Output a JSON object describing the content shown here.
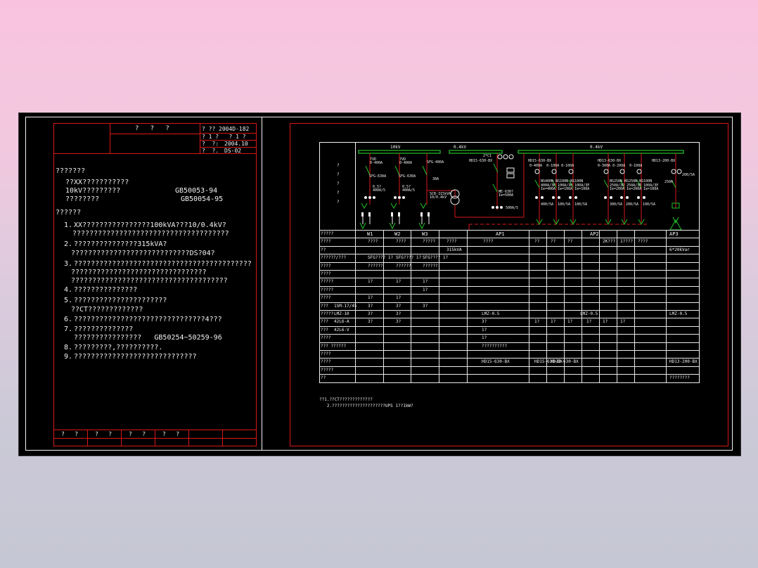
{
  "left_sheet": {
    "title_block": {
      "title": "?   ?   ?",
      "rows": [
        {
          "label": "? ??",
          "value": "2004D-182"
        },
        {
          "label": "? 1 ?   ? 1 ?",
          "value": ""
        },
        {
          "label": "?  ?:",
          "value": "2004.10"
        },
        {
          "label": "?  ?.",
          "value": "DS-02"
        }
      ]
    },
    "heading": "???????",
    "intro": [
      "??XX???????????",
      "10kV?????????",
      "????????"
    ],
    "standards": [
      "GB50053-94",
      "GB50054-95"
    ],
    "section_heading": "??????",
    "notes": [
      {
        "n": "1.",
        "lines": [
          "XX????????????????100kVA???10/0.4kV?",
          "?????????????????????????????????????"
        ]
      },
      {
        "n": "2.",
        "lines": [
          "???????????????315kVA?",
          "????????????????????????????DS?04?"
        ]
      },
      {
        "n": "3.",
        "lines": [
          "??????????????????????????????????????????",
          "????????????????????????????????",
          "?????????????????????????????????????"
        ]
      },
      {
        "n": "4.",
        "lines": [
          "???????????????"
        ]
      },
      {
        "n": "5.",
        "lines": [
          "??????????????????????",
          "??CT?????????????"
        ]
      },
      {
        "n": "6.",
        "lines": [
          "???????????????????????????????4???"
        ]
      },
      {
        "n": "7.",
        "lines": [
          "??????????????",
          "????????????????   GB50254~50259-96"
        ]
      },
      {
        "n": "8.",
        "lines": [
          "?????????,??????????."
        ]
      },
      {
        "n": "9.",
        "lines": [
          "?????????????????????????????"
        ]
      }
    ],
    "signature_row": [
      "?   ?",
      "?   ?",
      "?   ?",
      "?   ?"
    ]
  },
  "right_sheet": {
    "bus_labels": {
      "hv": "10kV",
      "lv1": "0.4kV",
      "lv2": "0.4kV"
    },
    "left_labels": [
      "?",
      "?",
      "?",
      "?",
      "?"
    ],
    "hv_switches": [
      {
        "top": "7VD\n0-400A",
        "mid": "SFG-630A",
        "low": "0.5?\n400A/5"
      },
      {
        "top": "7VD\n0-400A",
        "mid": "SFG-630A",
        "low": "0.5?\n400A/5"
      },
      {
        "top": "SFG-400A",
        "mid": "30A",
        "low": "SCB-315kVA\n10/0.4kV"
      }
    ],
    "transformer": "SCB-315kVA 10/0.4kV",
    "lv_main": {
      "breaker": "HD15-630-BX",
      "ct": "2*C1",
      "aux": "ME-630?\nIe=500A",
      "ratio": "500A/5"
    },
    "feeder_groups": [
      {
        "head": "HD15-630-BX",
        "range": "0-400A  0-100A 0-100A",
        "breakers": "NS400N NS100N NS100N\n400A/3P 100A/3P 100A/3P\nIe=400A Ie=100A Ie=100A",
        "cts": [
          "400/5A",
          "100/5A",
          "100/5A"
        ]
      },
      {
        "head": "HD13-630-BX",
        "range": "0-300A 0-200A  0-100A",
        "breakers": "NS250N NS250N NS100N\n250A/3P 250A/3P 100A/3P\nIe=200A Ie=200A Ie=100A",
        "cts": [
          "300/5A",
          "200/5A",
          "100/5A"
        ]
      },
      {
        "head": "HD13-200-BX",
        "range": "",
        "breakers": "250A",
        "cts": [
          "200/5A"
        ]
      }
    ],
    "table": {
      "row_labels": [
        "?????",
        "????",
        "??",
        "??????/???",
        "????",
        "????",
        "?????",
        "?????",
        "????",
        "???",
        "?????",
        "???",
        "???",
        "????",
        "??? ??????",
        "????",
        "????",
        "?????",
        "??"
      ],
      "col_headers": [
        "W1",
        "W2",
        "W3",
        "AP1",
        "AP2",
        "AP3"
      ],
      "cells": [
        {
          "r": 1,
          "c": "W1",
          "v": "????"
        },
        {
          "r": 1,
          "c": "W2",
          "v": "????"
        },
        {
          "r": 1,
          "c": "W3",
          "v": "?????"
        },
        {
          "r": 1,
          "c": "AP1a",
          "v": "????"
        },
        {
          "r": 1,
          "c": "AP1b",
          "v": "????"
        },
        {
          "r": 1,
          "c": "AP2a",
          "v": "??"
        },
        {
          "r": 1,
          "c": "AP2b",
          "v": "??"
        },
        {
          "r": 1,
          "c": "AP2c",
          "v": "??"
        },
        {
          "r": 1,
          "c": "AP2e",
          "v": "2K???"
        },
        {
          "r": 1,
          "c": "AP2f",
          "v": "1????"
        },
        {
          "r": 1,
          "c": "AP2g",
          "v": "????"
        },
        {
          "r": 2,
          "c": "AP1a",
          "v": "315kVA"
        },
        {
          "r": 2,
          "c": "AP3",
          "v": "6*20kVar"
        },
        {
          "r": 3,
          "c": "W1",
          "v": "SFG???? 1?"
        },
        {
          "r": 3,
          "c": "W2",
          "v": "SFG???? 1?"
        },
        {
          "r": 3,
          "c": "W3",
          "v": "SFG???? 1?"
        },
        {
          "r": 4,
          "c": "W1",
          "v": "??????"
        },
        {
          "r": 4,
          "c": "W2",
          "v": "??????"
        },
        {
          "r": 4,
          "c": "W3",
          "v": "??????"
        },
        {
          "r": 6,
          "c": "W1",
          "v": "1?"
        },
        {
          "r": 6,
          "c": "W2",
          "v": "1?"
        },
        {
          "r": 6,
          "c": "W3",
          "v": "1?"
        },
        {
          "r": 7,
          "c": "W3",
          "v": "1?"
        },
        {
          "r": 8,
          "c": "W1",
          "v": "1?"
        },
        {
          "r": 8,
          "c": "W2",
          "v": "1?"
        },
        {
          "r": 9,
          "c": "label2",
          "v": "1SM-17/45"
        },
        {
          "r": 9,
          "c": "W1",
          "v": "3?"
        },
        {
          "r": 9,
          "c": "W2",
          "v": "3?"
        },
        {
          "r": 9,
          "c": "W3",
          "v": "3?"
        },
        {
          "r": 10,
          "c": "label2",
          "v": "LMZ-10"
        },
        {
          "r": 10,
          "c": "W1",
          "v": "3?"
        },
        {
          "r": 10,
          "c": "W2",
          "v": "3?"
        },
        {
          "r": 10,
          "c": "AP1",
          "v": "LMZ-0.5"
        },
        {
          "r": 10,
          "c": "AP2",
          "v": "LMZ-0.5"
        },
        {
          "r": 10,
          "c": "AP3",
          "v": "LMZ-0.5"
        },
        {
          "r": 11,
          "c": "label2",
          "v": "42L6-A"
        },
        {
          "r": 11,
          "c": "W1",
          "v": "3?"
        },
        {
          "r": 11,
          "c": "W2",
          "v": "3?"
        },
        {
          "r": 11,
          "c": "AP1",
          "v": "3?"
        },
        {
          "r": 11,
          "c": "AP2a",
          "v": "1?"
        },
        {
          "r": 11,
          "c": "AP2b",
          "v": "1?"
        },
        {
          "r": 11,
          "c": "AP2c",
          "v": "1?"
        },
        {
          "r": 11,
          "c": "AP2d",
          "v": "1?"
        },
        {
          "r": 11,
          "c": "AP2e",
          "v": "1?"
        },
        {
          "r": 11,
          "c": "AP2f",
          "v": "1?"
        },
        {
          "r": 12,
          "c": "label2",
          "v": "42L6-V"
        },
        {
          "r": 12,
          "c": "AP1",
          "v": "1?"
        },
        {
          "r": 13,
          "c": "AP1",
          "v": "1?"
        },
        {
          "r": 14,
          "c": "AP1",
          "v": "??????????"
        },
        {
          "r": 16,
          "c": "AP1",
          "v": "HD15-630-BX"
        },
        {
          "r": 16,
          "c": "AP2a",
          "v": "HD15-630-BX"
        },
        {
          "r": 16,
          "c": "AP2b",
          "v": "HD13-630-BX"
        },
        {
          "r": 16,
          "c": "AP3",
          "v": "HD13-200-BX"
        },
        {
          "r": 18,
          "c": "AP3",
          "v": "????????"
        }
      ]
    },
    "footnotes": [
      "??1.??CT?????????????",
      "   2.?????????????????????UPS 1??1kW?"
    ]
  },
  "colors": {
    "border": "#d81818",
    "lines": "#f2f2f2",
    "busbar": "#22c22a",
    "drawing_bg": "#000000"
  }
}
